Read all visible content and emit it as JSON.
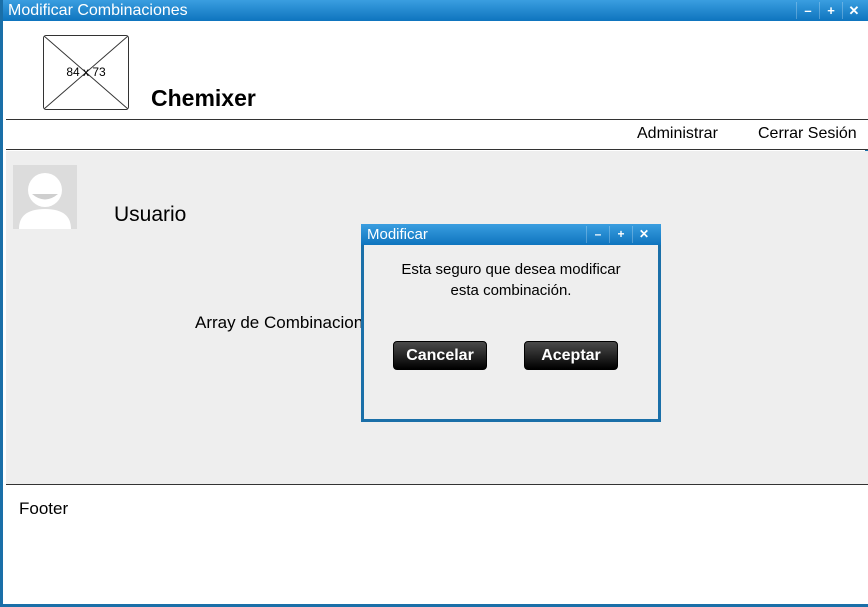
{
  "window": {
    "title": "Modificar Combinaciones",
    "controls": [
      "minimize-icon",
      "maximize-icon",
      "close-icon"
    ]
  },
  "header": {
    "logo_placeholder": "84 x 73",
    "app_name": "Chemixer"
  },
  "nav": {
    "admin_label": "Administrar",
    "logout_label": "Cerrar Sesión"
  },
  "main": {
    "user_label": "Usuario",
    "array_label": "Array de Combinaciones"
  },
  "footer": {
    "text": "Footer"
  },
  "dialog": {
    "title": "Modificar",
    "message_line1": "Esta seguro que desea modificar",
    "message_line2": "esta combinación.",
    "cancel_label": "Cancelar",
    "accept_label": "Aceptar"
  },
  "colors": {
    "titlebar": "#0e74be",
    "content_bg": "#eeeeee",
    "button_bg": "#000000"
  }
}
